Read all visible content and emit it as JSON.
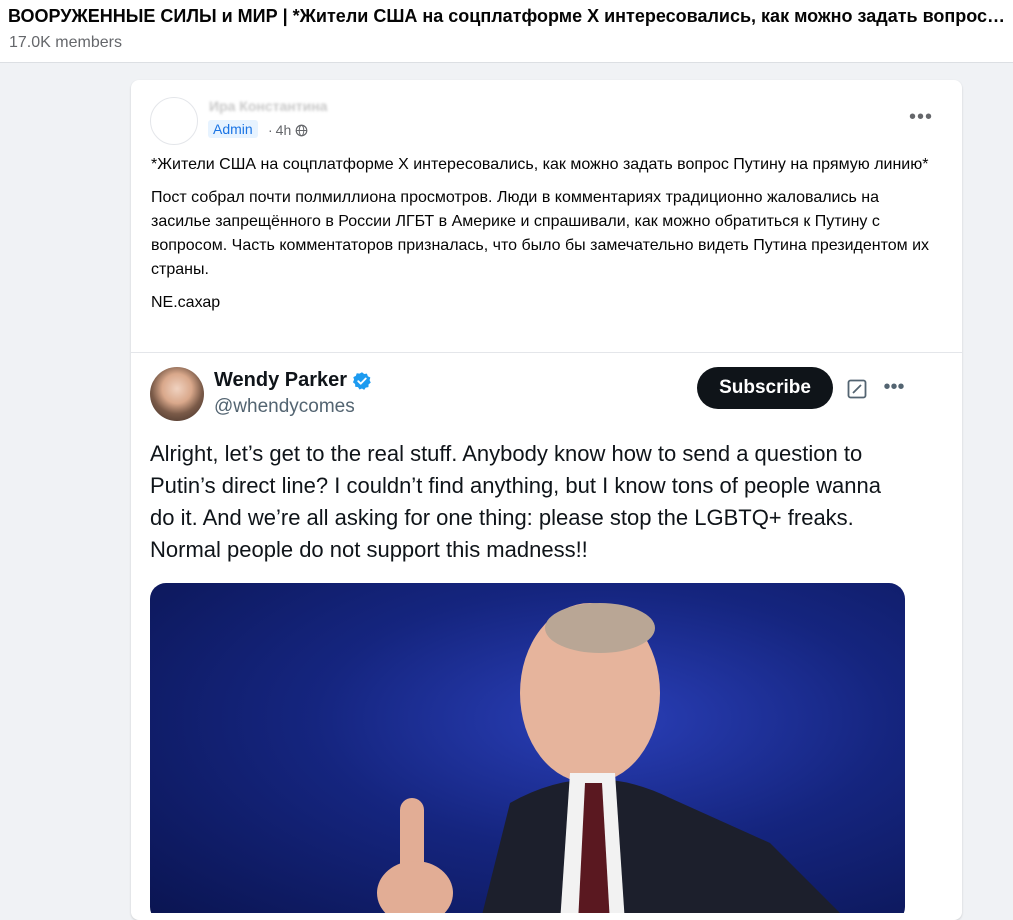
{
  "header": {
    "group_title": "ВООРУЖЕННЫЕ СИЛЫ и МИР | *Жители США на соцплатформе Х интересовались, как можно задать вопрос Путину на прямую линию*",
    "members": "17.0K members"
  },
  "post": {
    "author": "Ира Константина",
    "badge": "Admin",
    "sep": "·",
    "time": "4h",
    "paragraphs": [
      "*Жители США на соцплатформе Х интересовались, как можно задать вопрос Путину на прямую линию*",
      "Пост собрал почти полмиллиона просмотров. Люди в комментариях традиционно жаловались на засилье запрещённого в России ЛГБТ в Америке и спрашивали, как можно обратиться к Путину с вопросом. Часть комментаторов призналась, что было бы замечательно видеть Путина президентом их страны.",
      "NE.сахар"
    ]
  },
  "tweet": {
    "name": "Wendy Parker",
    "handle": "@whendycomes",
    "subscribe_label": "Subscribe",
    "text": "Alright, let’s get to the real stuff. Anybody know how to send a question to Putin’s direct line? I couldn’t find anything, but I know tons of people wanna do it. And we’re all asking for one thing: please stop the LGBTQ+ freaks. Normal people do not support this madness!!"
  },
  "icons": {
    "more": "more-horizontal-icon",
    "globe": "globe-icon",
    "verified": "verified-badge-icon",
    "grok": "grok-icon"
  },
  "colors": {
    "accent": "#1b74e4",
    "badge_bg": "#e7f3ff",
    "subscribe_bg": "#0f1419",
    "verified": "#1d9bf0"
  }
}
